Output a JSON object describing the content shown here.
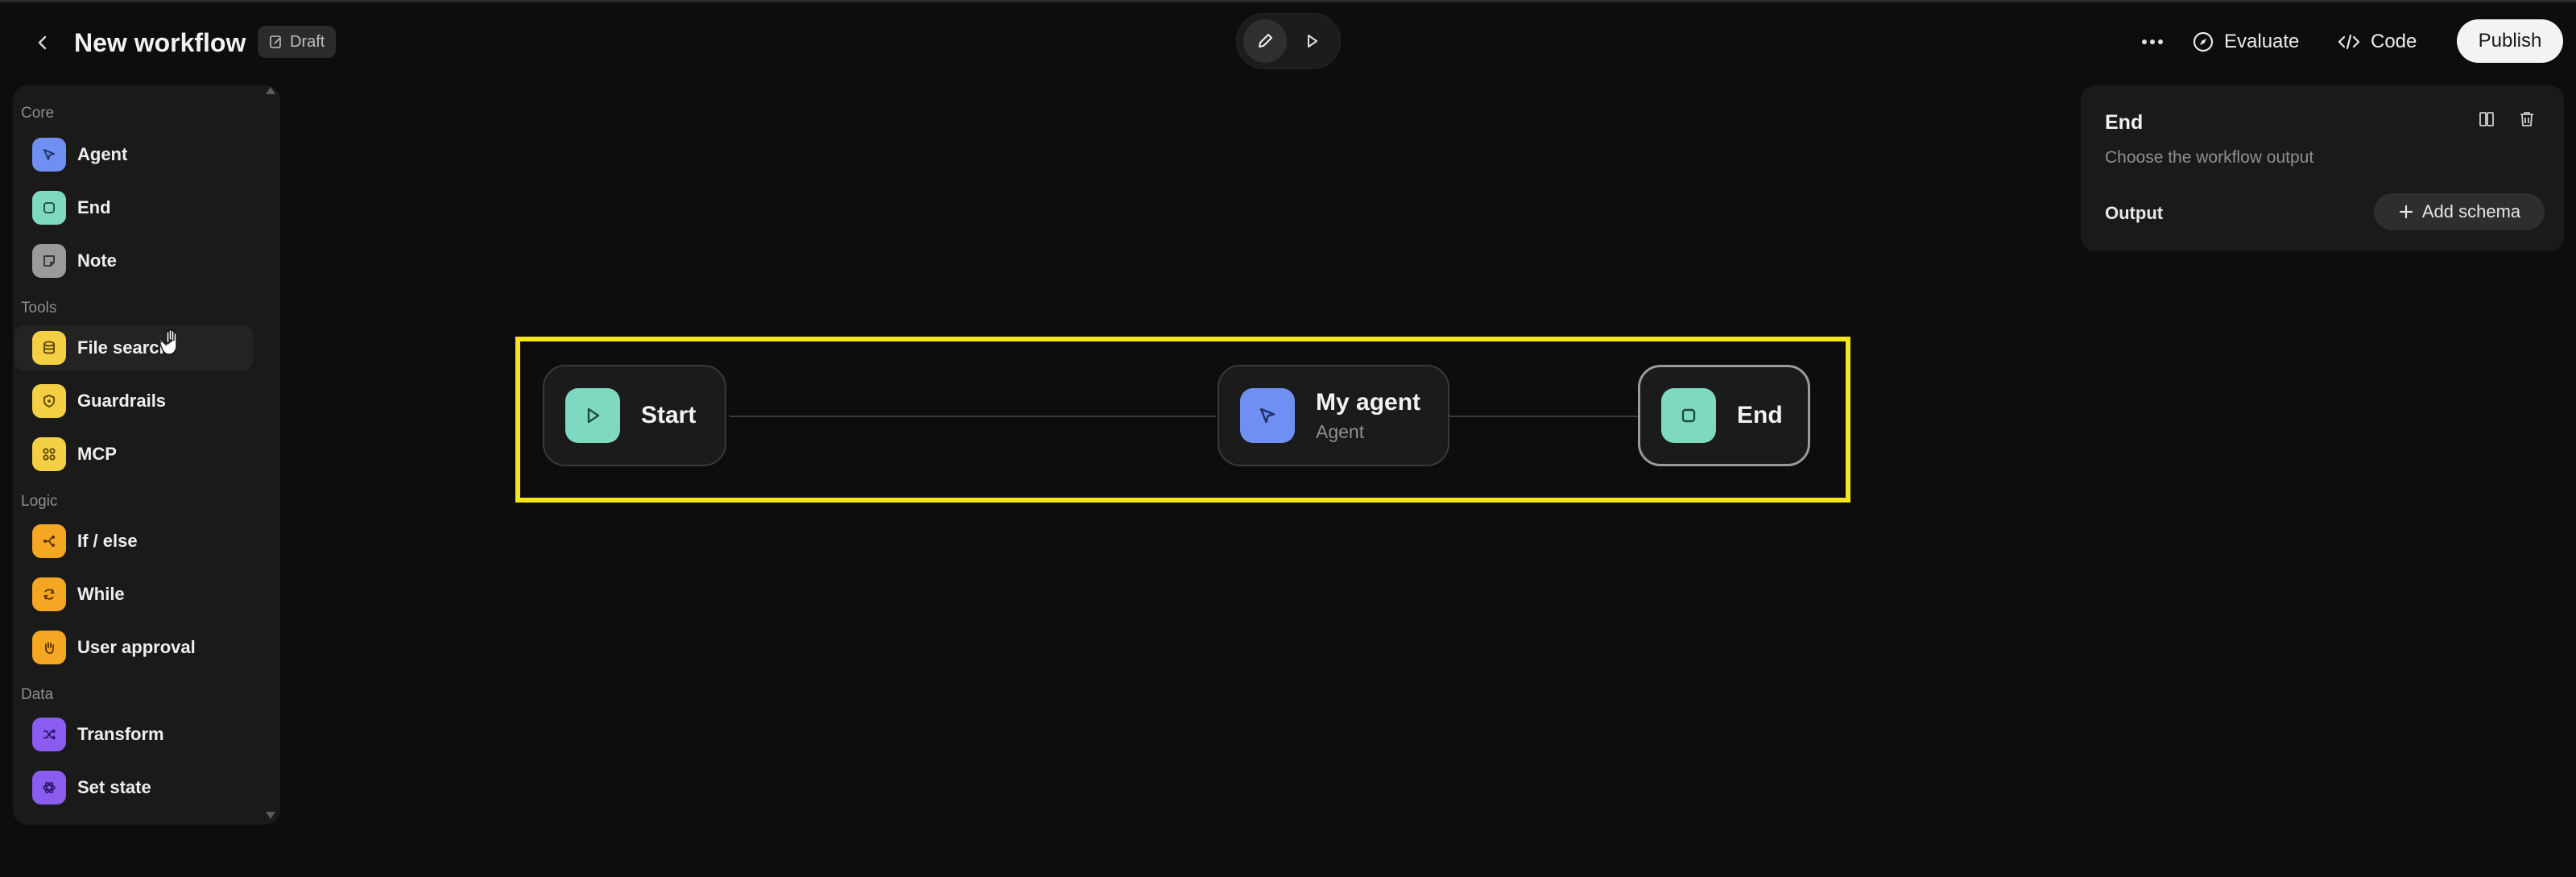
{
  "header": {
    "title": "New workflow",
    "draft_label": "Draft",
    "evaluate_label": "Evaluate",
    "code_label": "Code",
    "publish_label": "Publish"
  },
  "sidebar": {
    "sections": [
      {
        "title": "Core",
        "items": [
          {
            "label": "Agent",
            "icon": "cursor-arrow-icon",
            "color": "#6f8ff2"
          },
          {
            "label": "End",
            "icon": "stop-square-icon",
            "color": "#7fd8c0"
          },
          {
            "label": "Note",
            "icon": "note-icon",
            "color": "#9a9a9a"
          }
        ]
      },
      {
        "title": "Tools",
        "items": [
          {
            "label": "File search",
            "icon": "database-icon",
            "color": "#f2cf43"
          },
          {
            "label": "Guardrails",
            "icon": "shield-icon",
            "color": "#f2cf43"
          },
          {
            "label": "MCP",
            "icon": "grid-icon",
            "color": "#f2cf43"
          }
        ]
      },
      {
        "title": "Logic",
        "items": [
          {
            "label": "If / else",
            "icon": "branch-icon",
            "color": "#f5a623"
          },
          {
            "label": "While",
            "icon": "loop-icon",
            "color": "#f5a623"
          },
          {
            "label": "User approval",
            "icon": "hand-icon",
            "color": "#f5a623"
          }
        ]
      },
      {
        "title": "Data",
        "items": [
          {
            "label": "Transform",
            "icon": "shuffle-icon",
            "color": "#8a5cf0"
          },
          {
            "label": "Set state",
            "icon": "atom-icon",
            "color": "#8a5cf0"
          }
        ]
      }
    ]
  },
  "canvas": {
    "nodes": [
      {
        "title": "Start",
        "subtitle": "",
        "icon": "play-icon",
        "color": "#7fd8c0"
      },
      {
        "title": "My agent",
        "subtitle": "Agent",
        "icon": "cursor-arrow-icon",
        "color": "#6f8ff2"
      },
      {
        "title": "End",
        "subtitle": "",
        "icon": "stop-square-icon",
        "color": "#7fd8c0"
      }
    ],
    "highlight_color": "#f5e619"
  },
  "inspector": {
    "title": "End",
    "description": "Choose the workflow output",
    "output_label": "Output",
    "add_schema_label": "Add schema"
  }
}
